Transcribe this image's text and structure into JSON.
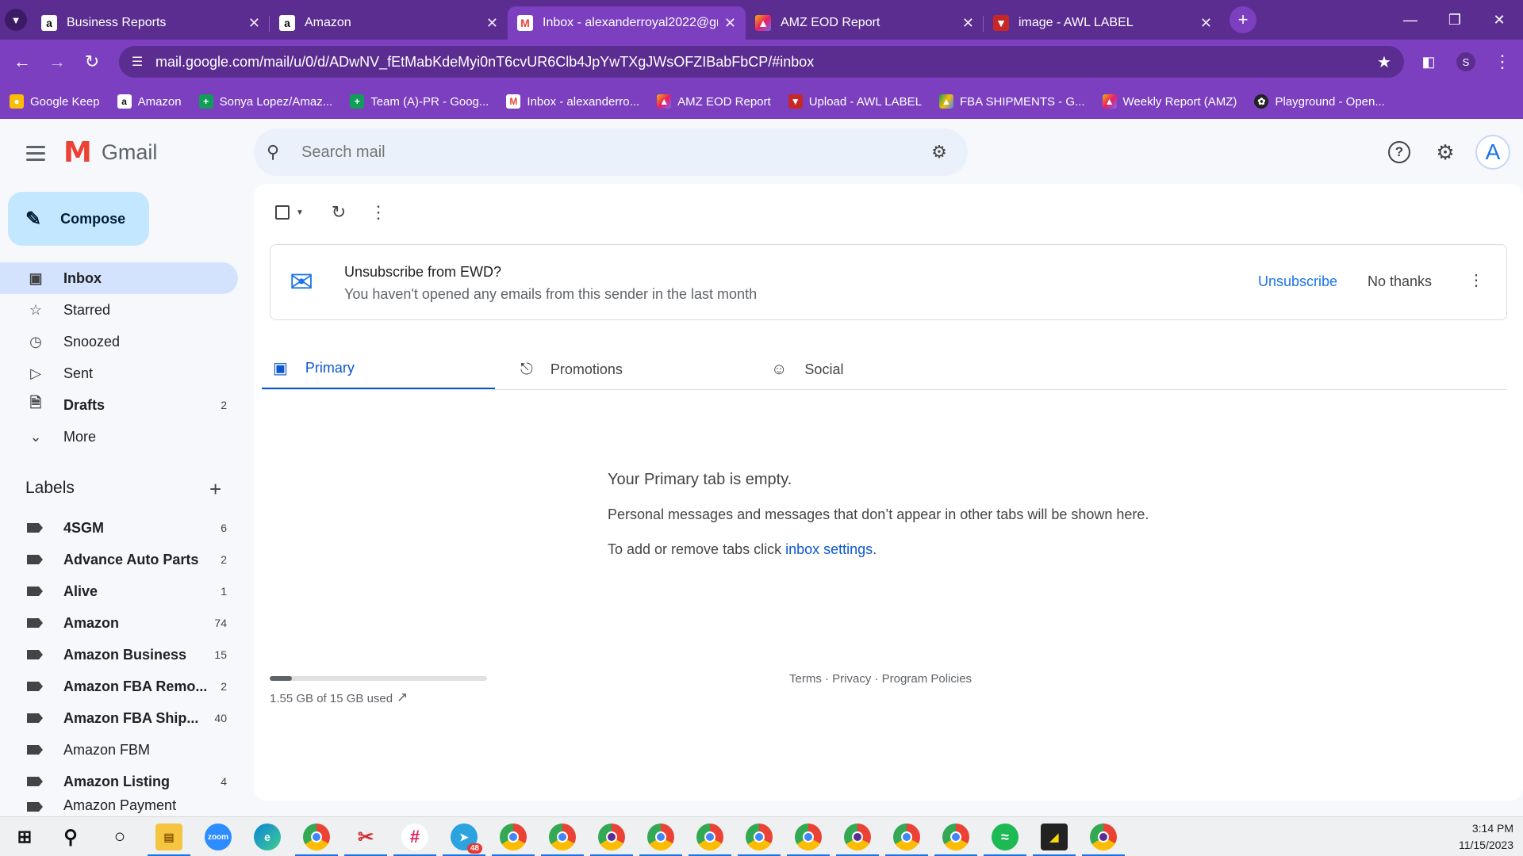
{
  "browser": {
    "tabs": [
      {
        "title": "Business Reports",
        "favicon": "amazon-icon",
        "active": false
      },
      {
        "title": "Amazon",
        "favicon": "amazon-icon",
        "active": false
      },
      {
        "title": "Inbox - alexanderroyal2022@gr",
        "favicon": "gmail-icon",
        "active": true
      },
      {
        "title": "AMZ EOD Report",
        "favicon": "clickup-icon",
        "active": false
      },
      {
        "title": "image - AWL LABEL",
        "favicon": "awl-icon",
        "active": false
      }
    ],
    "url": "mail.google.com/mail/u/0/d/ADwNV_fEtMabKdeMyi0nT6cvUR6Clb4JpYwTXgJWsOFZIBabFbCP/#inbox",
    "profile_initial": "S",
    "bookmarks": [
      {
        "label": "Google Keep",
        "icon": "keep-icon"
      },
      {
        "label": "Amazon",
        "icon": "amazon-icon"
      },
      {
        "label": "Sonya Lopez/Amaz...",
        "icon": "sheets-icon"
      },
      {
        "label": "Team (A)-PR - Goog...",
        "icon": "sheets-icon"
      },
      {
        "label": "Inbox - alexanderro...",
        "icon": "gmail-icon"
      },
      {
        "label": "AMZ EOD Report",
        "icon": "clickup-icon"
      },
      {
        "label": "Upload - AWL LABEL",
        "icon": "awl-icon"
      },
      {
        "label": "FBA SHIPMENTS - G...",
        "icon": "drive-icon"
      },
      {
        "label": "Weekly Report (AMZ)",
        "icon": "clickup-icon"
      },
      {
        "label": "Playground - Open...",
        "icon": "openai-icon"
      }
    ]
  },
  "gmail": {
    "logo_text": "Gmail",
    "search_placeholder": "Search mail",
    "avatar_initial": "A",
    "compose_label": "Compose",
    "nav": [
      {
        "label": "Inbox",
        "icon": "inbox-icon",
        "count": "",
        "active": true
      },
      {
        "label": "Starred",
        "icon": "star-icon",
        "count": ""
      },
      {
        "label": "Snoozed",
        "icon": "clock-icon",
        "count": ""
      },
      {
        "label": "Sent",
        "icon": "send-icon",
        "count": ""
      },
      {
        "label": "Drafts",
        "icon": "draft-icon",
        "count": "2"
      },
      {
        "label": "More",
        "icon": "chevron-down-icon",
        "count": ""
      }
    ],
    "labels_title": "Labels",
    "labels": [
      {
        "name": "4SGM",
        "count": "6"
      },
      {
        "name": "Advance Auto Parts",
        "count": "2"
      },
      {
        "name": "Alive",
        "count": "1"
      },
      {
        "name": "Amazon",
        "count": "74"
      },
      {
        "name": "Amazon Business",
        "count": "15"
      },
      {
        "name": "Amazon FBA Remo...",
        "count": "2"
      },
      {
        "name": "Amazon FBA Ship...",
        "count": "40"
      },
      {
        "name": "Amazon FBM",
        "count": ""
      },
      {
        "name": "Amazon Listing",
        "count": "4"
      },
      {
        "name": "Amazon Payment",
        "count": ""
      }
    ],
    "banner": {
      "title": "Unsubscribe from EWD?",
      "subtitle": "You haven't opened any emails from this sender in the last month",
      "unsubscribe": "Unsubscribe",
      "no_thanks": "No thanks"
    },
    "categories": [
      {
        "label": "Primary",
        "active": true
      },
      {
        "label": "Promotions"
      },
      {
        "label": "Social"
      }
    ],
    "empty": {
      "title": "Your Primary tab is empty.",
      "desc": "Personal messages and messages that don’t appear in other tabs will be shown here.",
      "settings_prefix": "To add or remove tabs click ",
      "settings_link": "inbox settings",
      "settings_suffix": "."
    },
    "storage": {
      "text": "1.55 GB of 15 GB used",
      "used_fraction": 0.103
    },
    "footer": "Terms · Privacy · Program Policies"
  },
  "taskbar": {
    "time": "3:14 PM",
    "date": "11/15/2023",
    "telegram_badge": "48"
  }
}
